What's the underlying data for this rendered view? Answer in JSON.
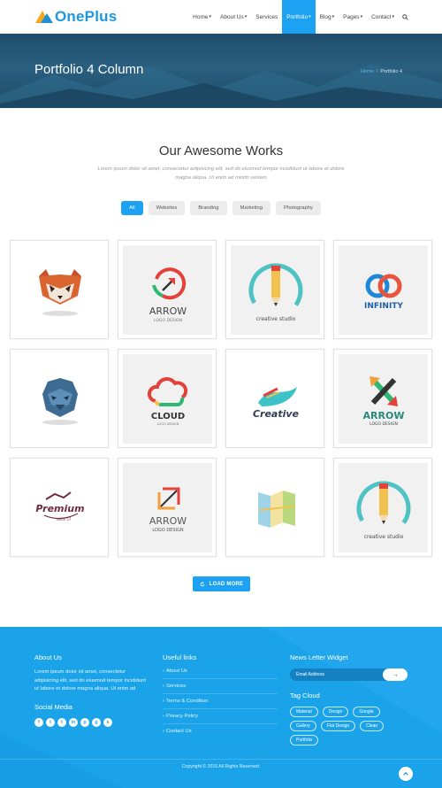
{
  "brand": {
    "name": "OnePlus"
  },
  "nav": {
    "items": [
      {
        "label": "Home",
        "caret": true
      },
      {
        "label": "About Us",
        "caret": true
      },
      {
        "label": "Services",
        "caret": false
      },
      {
        "label": "Portfolio",
        "caret": true,
        "active": true
      },
      {
        "label": "Blog",
        "caret": true
      },
      {
        "label": "Pages",
        "caret": true
      },
      {
        "label": "Contact",
        "caret": true
      }
    ],
    "search_icon": "search-icon"
  },
  "banner": {
    "title": "Portfolio 4 Column",
    "breadcrumb_home": "Home",
    "breadcrumb_sep": "/",
    "breadcrumb_current": "Portfolio 4"
  },
  "works": {
    "title": "Our Awesome Works",
    "description": "Lorem ipsum dolor sit amet, consectetur adipisicing elit, sed do eiusmod tempor incididunt ut labore et dolore magna aliqua. Ut enim ad minim veniam",
    "filters": [
      "All",
      "Websites",
      "Branding",
      "Marketing",
      "Photography"
    ],
    "active_filter": "All",
    "items": [
      {
        "logo": "red-panda"
      },
      {
        "logo": "arrow-circle",
        "text": "ARROW",
        "sub": "LOGO DESIGN"
      },
      {
        "logo": "pencil-badge",
        "text": "creative studio"
      },
      {
        "logo": "infinity",
        "text": "INFINITY"
      },
      {
        "logo": "gorilla"
      },
      {
        "logo": "cloud",
        "text": "CLOUD",
        "sub": "LOGO DESIGN"
      },
      {
        "logo": "wave",
        "text": "Creative"
      },
      {
        "logo": "arrow-cross",
        "text": "ARROW",
        "sub": "LOGO DESIGN"
      },
      {
        "logo": "premium",
        "text": "Premium",
        "sub": "since 57"
      },
      {
        "logo": "arrow-square",
        "text": "ARROW",
        "sub": "LOGO DESIGN"
      },
      {
        "logo": "map"
      },
      {
        "logo": "pencil-badge",
        "text": "creative studio"
      }
    ],
    "load_more": "LOAD MORE"
  },
  "footer": {
    "about_title": "About Us",
    "about_text": "Lorem ipsum dolor sit amet, consectetur adipisicing elit, sed do eiusmod tempor incididunt ut labore et dolore magna aliqua. Ut enim ad",
    "social_title": "Social Media",
    "social_icons": [
      "f",
      "t",
      "t",
      "in",
      "p",
      "g",
      "s"
    ],
    "links_title": "Useful links",
    "links": [
      "About Us",
      "Services",
      "Terms & Condition",
      "Privacy Policy",
      "Contact Us"
    ],
    "newsletter_title": "News Letter Widget",
    "newsletter_placeholder": "Email Address",
    "newsletter_button": "→",
    "tags_title": "Tag Cloud",
    "tags": [
      "Material",
      "Design",
      "Google",
      "Gallery",
      "Flat Design",
      "Clean",
      "Portfolio"
    ],
    "copyright": "Copyright © 2016 All Rights Reserved."
  },
  "colors": {
    "accent": "#1da1f2",
    "footer_bg": "#1ba3ea",
    "banner_bg": "#24587a"
  }
}
